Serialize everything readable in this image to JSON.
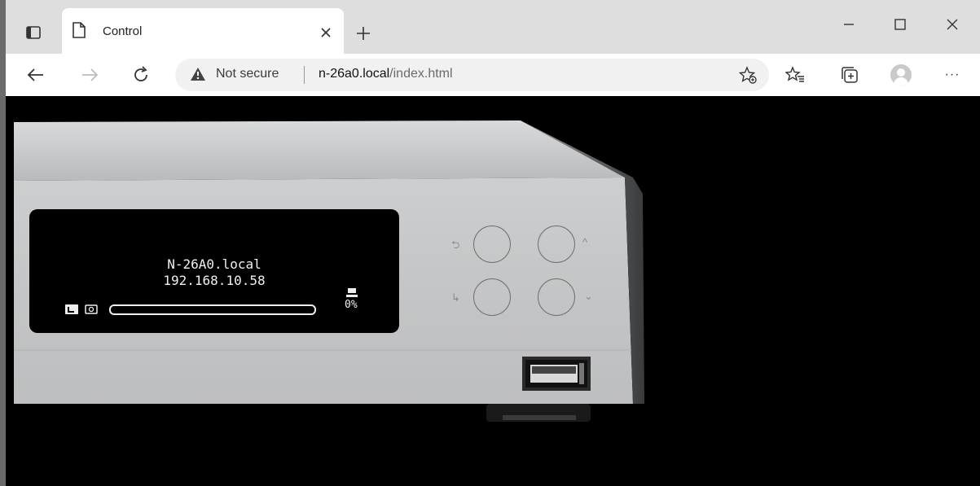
{
  "browser": {
    "tab": {
      "title": "Control",
      "close_icon": "close-icon"
    },
    "new_tab_icon": "plus-icon",
    "window_controls": [
      "minimize-icon",
      "maximize-icon",
      "close-icon"
    ],
    "nav": {
      "back": "back-arrow-icon",
      "forward": "forward-arrow-icon",
      "reload": "reload-icon"
    },
    "address": {
      "security_label": "Not secure",
      "host": "n-26a0.local",
      "path": "/index.html"
    },
    "toolbar": [
      "add-favorite-icon",
      "favorites-icon",
      "collections-icon",
      "profile-avatar",
      "more-icon"
    ],
    "more_label": "···"
  },
  "device": {
    "display": {
      "hostname": "N-26A0.local",
      "ip": "192.168.10.58",
      "progress_percent": 0,
      "percent_label": "0%"
    },
    "colors": {
      "body": "#c7c8c9",
      "screen": "#000000",
      "text": "#f0f0f0"
    }
  }
}
